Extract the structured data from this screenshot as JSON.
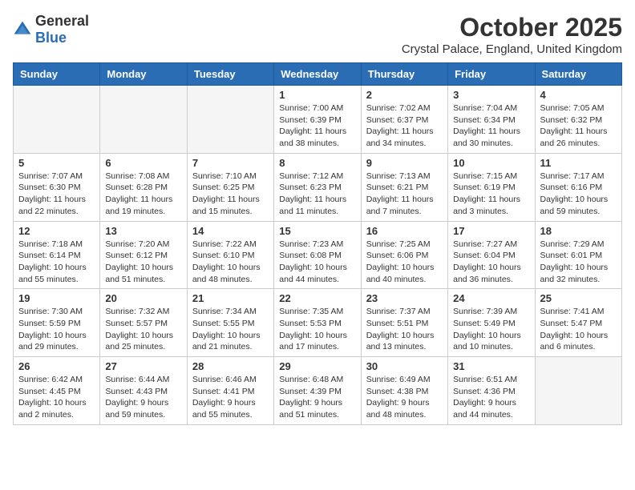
{
  "header": {
    "logo_general": "General",
    "logo_blue": "Blue",
    "month": "October 2025",
    "location": "Crystal Palace, England, United Kingdom"
  },
  "weekdays": [
    "Sunday",
    "Monday",
    "Tuesday",
    "Wednesday",
    "Thursday",
    "Friday",
    "Saturday"
  ],
  "weeks": [
    [
      {
        "day": "",
        "info": ""
      },
      {
        "day": "",
        "info": ""
      },
      {
        "day": "",
        "info": ""
      },
      {
        "day": "1",
        "info": "Sunrise: 7:00 AM\nSunset: 6:39 PM\nDaylight: 11 hours\nand 38 minutes."
      },
      {
        "day": "2",
        "info": "Sunrise: 7:02 AM\nSunset: 6:37 PM\nDaylight: 11 hours\nand 34 minutes."
      },
      {
        "day": "3",
        "info": "Sunrise: 7:04 AM\nSunset: 6:34 PM\nDaylight: 11 hours\nand 30 minutes."
      },
      {
        "day": "4",
        "info": "Sunrise: 7:05 AM\nSunset: 6:32 PM\nDaylight: 11 hours\nand 26 minutes."
      }
    ],
    [
      {
        "day": "5",
        "info": "Sunrise: 7:07 AM\nSunset: 6:30 PM\nDaylight: 11 hours\nand 22 minutes."
      },
      {
        "day": "6",
        "info": "Sunrise: 7:08 AM\nSunset: 6:28 PM\nDaylight: 11 hours\nand 19 minutes."
      },
      {
        "day": "7",
        "info": "Sunrise: 7:10 AM\nSunset: 6:25 PM\nDaylight: 11 hours\nand 15 minutes."
      },
      {
        "day": "8",
        "info": "Sunrise: 7:12 AM\nSunset: 6:23 PM\nDaylight: 11 hours\nand 11 minutes."
      },
      {
        "day": "9",
        "info": "Sunrise: 7:13 AM\nSunset: 6:21 PM\nDaylight: 11 hours\nand 7 minutes."
      },
      {
        "day": "10",
        "info": "Sunrise: 7:15 AM\nSunset: 6:19 PM\nDaylight: 11 hours\nand 3 minutes."
      },
      {
        "day": "11",
        "info": "Sunrise: 7:17 AM\nSunset: 6:16 PM\nDaylight: 10 hours\nand 59 minutes."
      }
    ],
    [
      {
        "day": "12",
        "info": "Sunrise: 7:18 AM\nSunset: 6:14 PM\nDaylight: 10 hours\nand 55 minutes."
      },
      {
        "day": "13",
        "info": "Sunrise: 7:20 AM\nSunset: 6:12 PM\nDaylight: 10 hours\nand 51 minutes."
      },
      {
        "day": "14",
        "info": "Sunrise: 7:22 AM\nSunset: 6:10 PM\nDaylight: 10 hours\nand 48 minutes."
      },
      {
        "day": "15",
        "info": "Sunrise: 7:23 AM\nSunset: 6:08 PM\nDaylight: 10 hours\nand 44 minutes."
      },
      {
        "day": "16",
        "info": "Sunrise: 7:25 AM\nSunset: 6:06 PM\nDaylight: 10 hours\nand 40 minutes."
      },
      {
        "day": "17",
        "info": "Sunrise: 7:27 AM\nSunset: 6:04 PM\nDaylight: 10 hours\nand 36 minutes."
      },
      {
        "day": "18",
        "info": "Sunrise: 7:29 AM\nSunset: 6:01 PM\nDaylight: 10 hours\nand 32 minutes."
      }
    ],
    [
      {
        "day": "19",
        "info": "Sunrise: 7:30 AM\nSunset: 5:59 PM\nDaylight: 10 hours\nand 29 minutes."
      },
      {
        "day": "20",
        "info": "Sunrise: 7:32 AM\nSunset: 5:57 PM\nDaylight: 10 hours\nand 25 minutes."
      },
      {
        "day": "21",
        "info": "Sunrise: 7:34 AM\nSunset: 5:55 PM\nDaylight: 10 hours\nand 21 minutes."
      },
      {
        "day": "22",
        "info": "Sunrise: 7:35 AM\nSunset: 5:53 PM\nDaylight: 10 hours\nand 17 minutes."
      },
      {
        "day": "23",
        "info": "Sunrise: 7:37 AM\nSunset: 5:51 PM\nDaylight: 10 hours\nand 13 minutes."
      },
      {
        "day": "24",
        "info": "Sunrise: 7:39 AM\nSunset: 5:49 PM\nDaylight: 10 hours\nand 10 minutes."
      },
      {
        "day": "25",
        "info": "Sunrise: 7:41 AM\nSunset: 5:47 PM\nDaylight: 10 hours\nand 6 minutes."
      }
    ],
    [
      {
        "day": "26",
        "info": "Sunrise: 6:42 AM\nSunset: 4:45 PM\nDaylight: 10 hours\nand 2 minutes."
      },
      {
        "day": "27",
        "info": "Sunrise: 6:44 AM\nSunset: 4:43 PM\nDaylight: 9 hours\nand 59 minutes."
      },
      {
        "day": "28",
        "info": "Sunrise: 6:46 AM\nSunset: 4:41 PM\nDaylight: 9 hours\nand 55 minutes."
      },
      {
        "day": "29",
        "info": "Sunrise: 6:48 AM\nSunset: 4:39 PM\nDaylight: 9 hours\nand 51 minutes."
      },
      {
        "day": "30",
        "info": "Sunrise: 6:49 AM\nSunset: 4:38 PM\nDaylight: 9 hours\nand 48 minutes."
      },
      {
        "day": "31",
        "info": "Sunrise: 6:51 AM\nSunset: 4:36 PM\nDaylight: 9 hours\nand 44 minutes."
      },
      {
        "day": "",
        "info": ""
      }
    ]
  ]
}
